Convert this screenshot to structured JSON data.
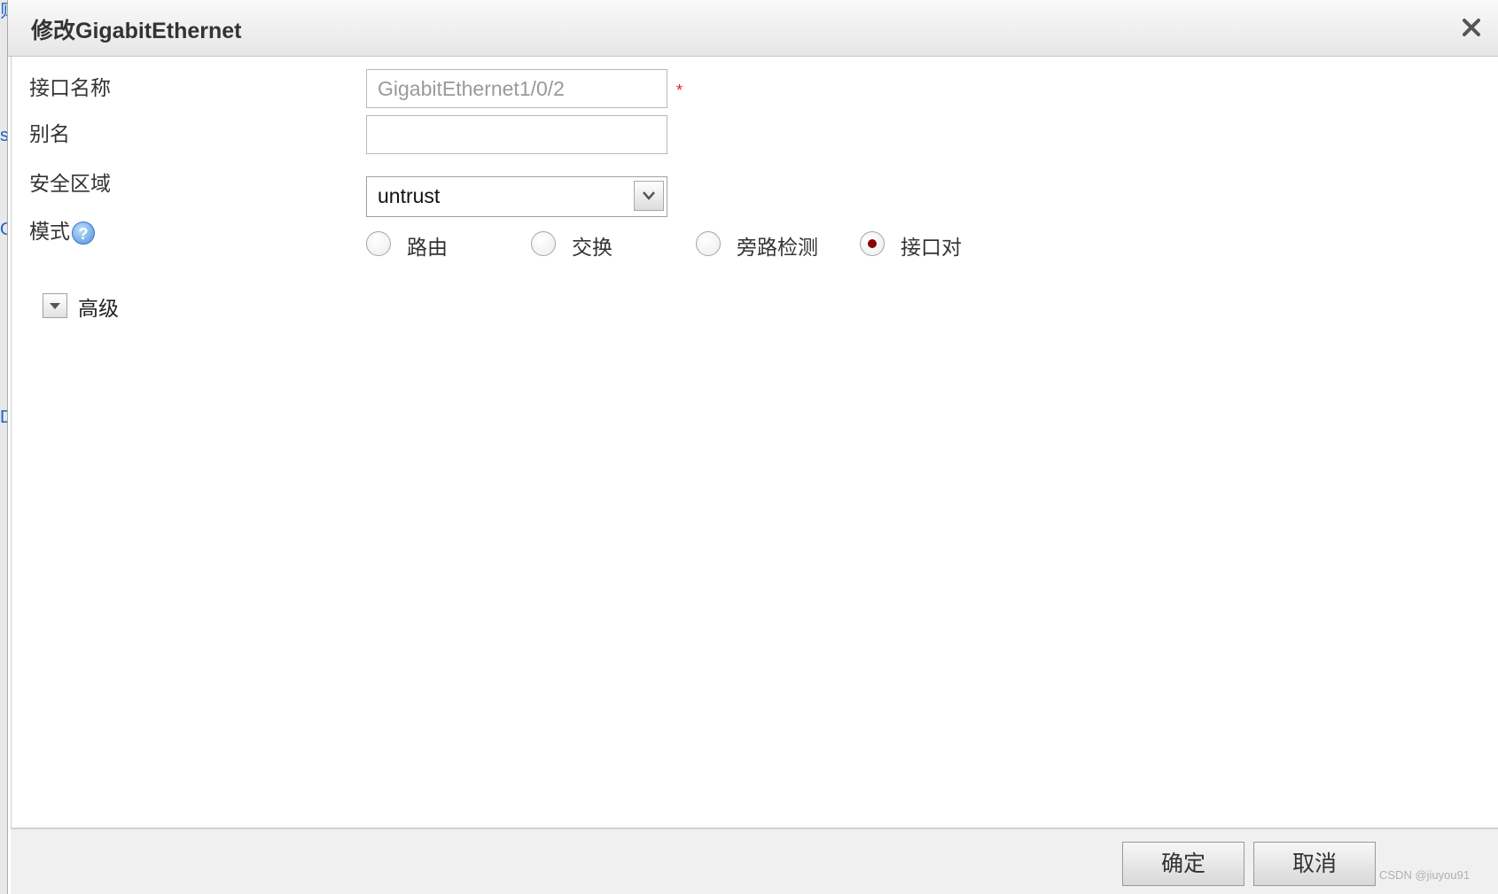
{
  "left_strip": {
    "marks": [
      "则",
      "s",
      "G",
      "D"
    ]
  },
  "dialog": {
    "title": "修改GigabitEthernet",
    "close_label": "×"
  },
  "form": {
    "interface_name": {
      "label": "接口名称",
      "value": "GigabitEthernet1/0/2",
      "required_mark": "*"
    },
    "alias": {
      "label": "别名",
      "value": ""
    },
    "security_zone": {
      "label": "安全区域",
      "selected": "untrust"
    },
    "mode": {
      "label": "模式",
      "help_glyph": "?",
      "options": [
        {
          "label": "路由",
          "selected": false
        },
        {
          "label": "交换",
          "selected": false
        },
        {
          "label": "旁路检测",
          "selected": false
        },
        {
          "label": "接口对",
          "selected": true
        }
      ]
    },
    "advanced": {
      "label": "高级"
    }
  },
  "footer": {
    "ok_label": "确定",
    "cancel_label": "取消"
  },
  "watermark": "CSDN @jiuyou91",
  "colors": {
    "radio_selected": "#8b0000",
    "required": "#e02020",
    "help_icon": "#4f8fd8"
  }
}
